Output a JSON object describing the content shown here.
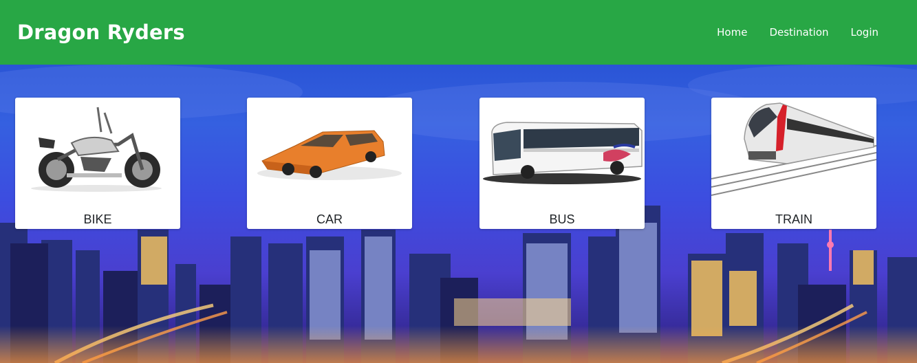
{
  "header": {
    "brand": "Dragon Ryders",
    "nav": [
      "Home",
      "Destination",
      "Login"
    ],
    "color": "#28a745"
  },
  "cards": [
    {
      "label": "BIKE",
      "icon": "motorcycle-icon"
    },
    {
      "label": "CAR",
      "icon": "car-icon"
    },
    {
      "label": "BUS",
      "icon": "bus-icon"
    },
    {
      "label": "TRAIN",
      "icon": "train-icon"
    }
  ],
  "background": {
    "scene": "city-skyline-night"
  }
}
